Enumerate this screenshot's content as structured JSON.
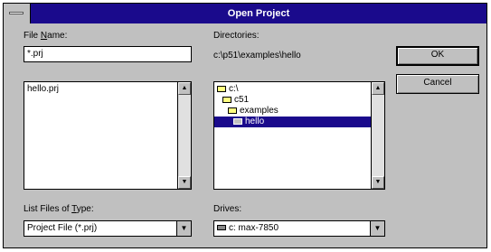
{
  "window": {
    "title": "Open Project"
  },
  "file_name": {
    "label_pre": "File ",
    "label_u": "N",
    "label_post": "ame:",
    "value": "*.prj",
    "files": [
      "hello.prj"
    ]
  },
  "directories": {
    "label": "Directories:",
    "path": "c:\\p51\\examples\\hello",
    "items": [
      {
        "name": "c:\\",
        "state": "open"
      },
      {
        "name": "c51",
        "state": "open"
      },
      {
        "name": "examples",
        "state": "open"
      },
      {
        "name": "hello",
        "state": "selected"
      }
    ]
  },
  "file_type": {
    "label_pre": "List Files of ",
    "label_u": "T",
    "label_post": "ype:",
    "value": "Project File (*.prj)"
  },
  "drives": {
    "label": "Drives:",
    "value": "c: max-7850"
  },
  "buttons": {
    "ok": "OK",
    "cancel": "Cancel"
  }
}
